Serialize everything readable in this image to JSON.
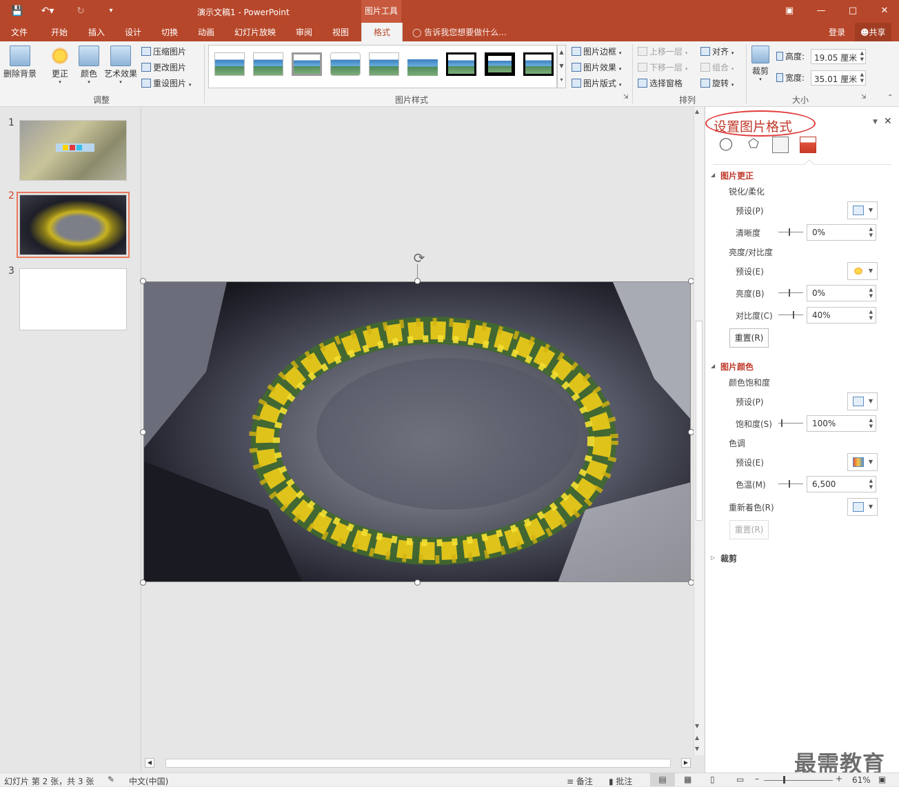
{
  "app": {
    "window_title": "演示文稿1 - PowerPoint",
    "context_tab": "图片工具",
    "signin": "登录",
    "share": "共享"
  },
  "menu": {
    "tabs": [
      "文件",
      "开始",
      "插入",
      "设计",
      "切换",
      "动画",
      "幻灯片放映",
      "审阅",
      "视图",
      "格式"
    ],
    "tell_me": "告诉我您想要做什么..."
  },
  "ribbon": {
    "remove_bg": "删除背景",
    "corrections": "更正",
    "color": "颜色",
    "artistic": "艺术效果",
    "compress": "压缩图片",
    "change": "更改图片",
    "reset": "重设图片",
    "group_adjust": "调整",
    "group_styles": "图片样式",
    "border": "图片边框",
    "effects": "图片效果",
    "layout": "图片版式",
    "bring_forward": "上移一层",
    "send_backward": "下移一层",
    "selection_pane": "选择窗格",
    "align": "对齐",
    "group": "组合",
    "rotate": "旋转",
    "group_arrange": "排列",
    "crop": "裁剪",
    "height_label": "高度:",
    "height_value": "19.05 厘米",
    "width_label": "宽度:",
    "width_value": "35.01 厘米",
    "group_size": "大小"
  },
  "slides": {
    "numbers": [
      "1",
      "2",
      "3"
    ],
    "selected": "2"
  },
  "pane": {
    "title": "设置图片格式",
    "section_corrections": "图片更正",
    "sharpen_soften": "锐化/柔化",
    "preset1": "预设(P)",
    "sharpness": "清晰度",
    "sharpness_value": "0%",
    "brightness_contrast": "亮度/对比度",
    "preset2": "预设(E)",
    "brightness": "亮度(B)",
    "brightness_value": "0%",
    "contrast": "对比度(C)",
    "contrast_value": "40%",
    "reset1": "重置(R)",
    "section_color": "图片颜色",
    "saturation_group": "颜色饱和度",
    "preset3": "预设(P)",
    "saturation": "饱和度(S)",
    "saturation_value": "100%",
    "tone_group": "色调",
    "preset4": "预设(E)",
    "temperature": "色温(M)",
    "temperature_value": "6,500",
    "recolor": "重新着色(R)",
    "reset2": "重置(R)",
    "section_crop": "裁剪"
  },
  "status": {
    "slide_info": "幻灯片 第 2 张，共 3 张",
    "language": "中文(中国)",
    "notes": "备注",
    "comments": "批注",
    "zoom": "61%"
  },
  "watermark": "最需教育"
}
